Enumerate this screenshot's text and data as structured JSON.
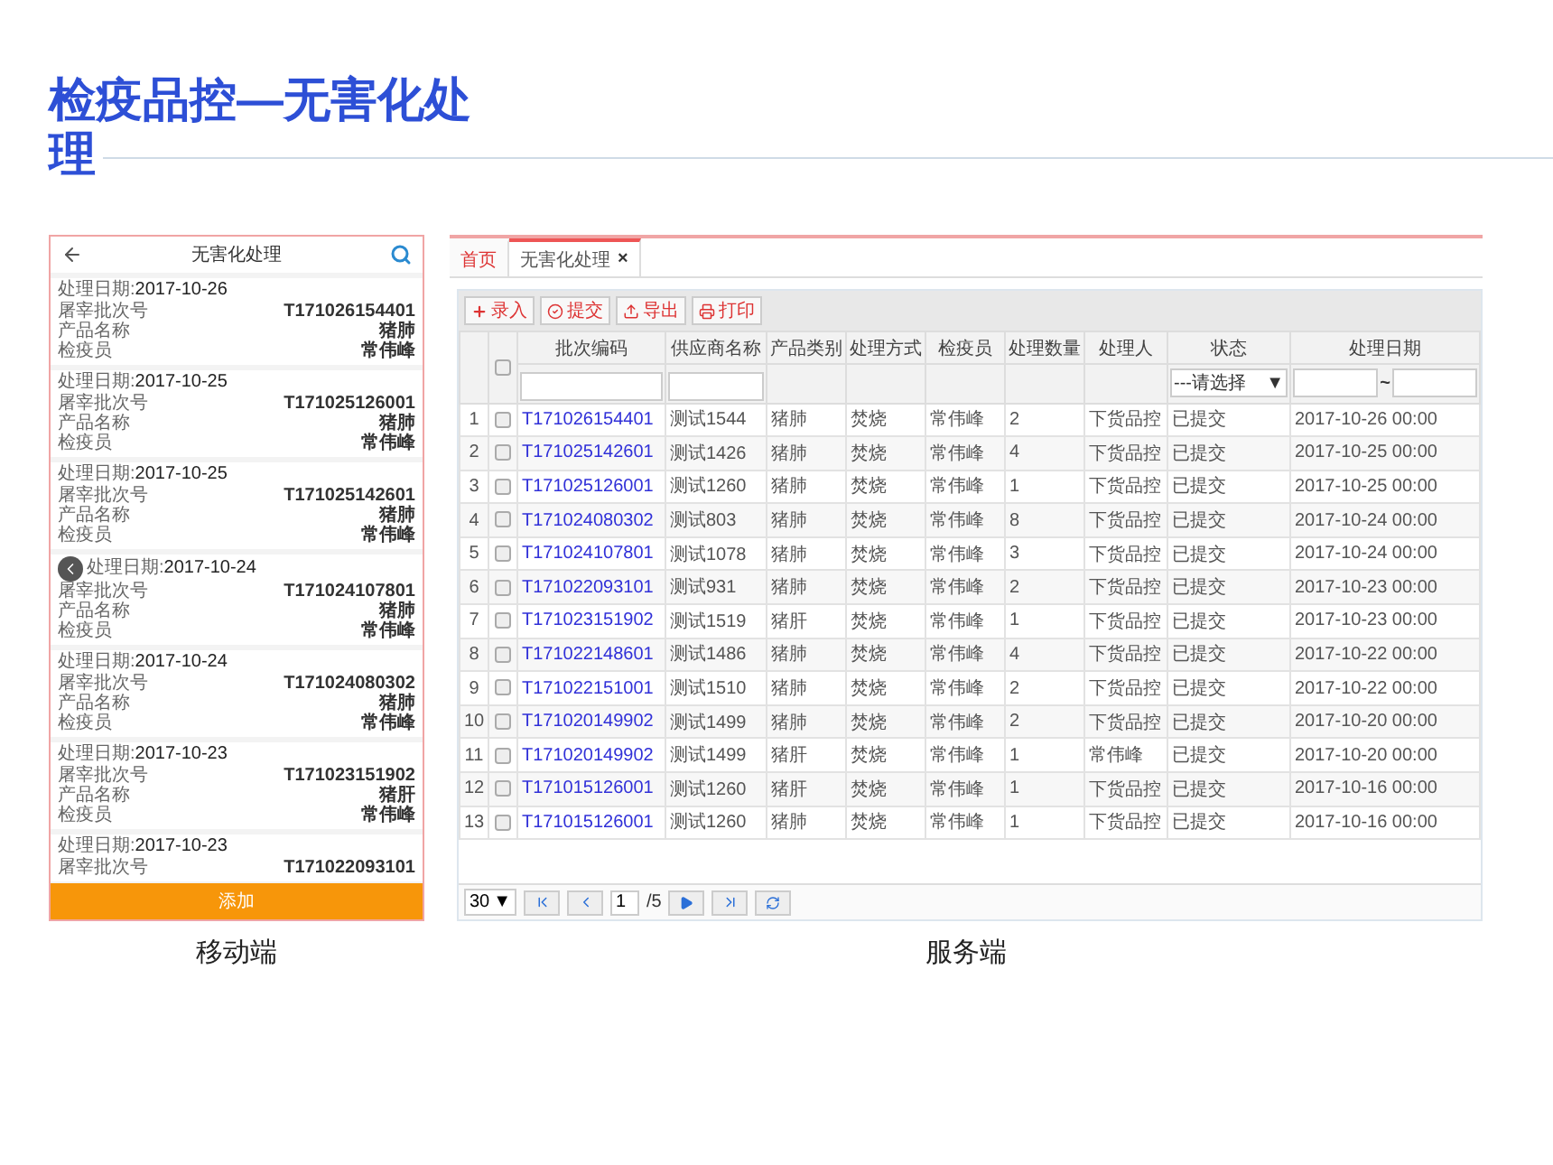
{
  "title": "检疫品控—无害化处理",
  "mobile": {
    "header": "无害化处理",
    "caption": "移动端",
    "add_button": "添加",
    "cards": [
      {
        "title": "处理日期:**2017-10-26**",
        "fields": [
          {
            "label": "屠宰批次号",
            "value": "T171026154401"
          },
          {
            "label": "产品名称",
            "value": "猪肺"
          },
          {
            "label": "检疫员",
            "value": "常伟峰"
          }
        ]
      },
      {
        "title": "处理日期:**2017-10-25**",
        "fields": [
          {
            "label": "屠宰批次号",
            "value": "T171025126001"
          },
          {
            "label": "产品名称",
            "value": "猪肺"
          },
          {
            "label": "检疫员",
            "value": "常伟峰"
          }
        ]
      },
      {
        "title": "处理日期:**2017-10-25**",
        "fields": [
          {
            "label": "屠宰批次号",
            "value": "T171025142601"
          },
          {
            "label": "产品名称",
            "value": "猪肺"
          },
          {
            "label": "检疫员",
            "value": "常伟峰"
          }
        ]
      },
      {
        "title": "处理日期:**2017-10-24**",
        "fields": [
          {
            "label": "屠宰批次号",
            "value": "T171024107801"
          },
          {
            "label": "产品名称",
            "value": "猪肺"
          },
          {
            "label": "检疫员",
            "value": "常伟峰"
          }
        ]
      },
      {
        "title": "处理日期:**2017-10-24**",
        "fields": [
          {
            "label": "屠宰批次号",
            "value": "T171024080302"
          },
          {
            "label": "产品名称",
            "value": "猪肺"
          },
          {
            "label": "检疫员",
            "value": "常伟峰"
          }
        ]
      },
      {
        "title": "处理日期:**2017-10-23**",
        "fields": [
          {
            "label": "屠宰批次号",
            "value": "T171023151902"
          },
          {
            "label": "产品名称",
            "value": "猪肝"
          },
          {
            "label": "检疫员",
            "value": "常伟峰"
          }
        ]
      },
      {
        "title": "处理日期:**2017-10-23**",
        "fields": [
          {
            "label": "屠宰批次号",
            "value": "T171022093101"
          }
        ]
      }
    ]
  },
  "server": {
    "caption": "服务端",
    "tabs": [
      {
        "label": "首页",
        "selected": false,
        "closable": false
      },
      {
        "label": "无害化处理",
        "selected": true,
        "closable": true
      }
    ],
    "close_mark": "×",
    "toolbar": [
      {
        "kind": "add",
        "label": "录入"
      },
      {
        "kind": "submit",
        "label": "提交"
      },
      {
        "kind": "export",
        "label": "导出"
      },
      {
        "kind": "print",
        "label": "打印"
      }
    ],
    "columns": [
      "批次编码",
      "供应商名称",
      "产品类别",
      "处理方式",
      "检疫员",
      "处理数量",
      "处理人",
      "状态",
      "处理日期"
    ],
    "header_checked": false,
    "status_filter": "---请选择",
    "dropdown_mark": "▼",
    "date_separator": "~",
    "rows": [
      {
        "no": "1",
        "checked": false,
        "cells": [
          "T171026154401",
          "测试1544",
          "猪肺",
          "焚烧",
          "常伟峰",
          "2",
          "下货品控",
          "已提交",
          "2017-10-26 00:00"
        ]
      },
      {
        "no": "2",
        "checked": false,
        "cells": [
          "T171025142601",
          "测试1426",
          "猪肺",
          "焚烧",
          "常伟峰",
          "4",
          "下货品控",
          "已提交",
          "2017-10-25 00:00"
        ]
      },
      {
        "no": "3",
        "checked": false,
        "cells": [
          "T171025126001",
          "测试1260",
          "猪肺",
          "焚烧",
          "常伟峰",
          "1",
          "下货品控",
          "已提交",
          "2017-10-25 00:00"
        ]
      },
      {
        "no": "4",
        "checked": false,
        "cells": [
          "T171024080302",
          "测试803",
          "猪肺",
          "焚烧",
          "常伟峰",
          "8",
          "下货品控",
          "已提交",
          "2017-10-24 00:00"
        ]
      },
      {
        "no": "5",
        "checked": false,
        "cells": [
          "T171024107801",
          "测试1078",
          "猪肺",
          "焚烧",
          "常伟峰",
          "3",
          "下货品控",
          "已提交",
          "2017-10-24 00:00"
        ]
      },
      {
        "no": "6",
        "checked": false,
        "cells": [
          "T171022093101",
          "测试931",
          "猪肺",
          "焚烧",
          "常伟峰",
          "2",
          "下货品控",
          "已提交",
          "2017-10-23 00:00"
        ]
      },
      {
        "no": "7",
        "checked": false,
        "cells": [
          "T171023151902",
          "测试1519",
          "猪肝",
          "焚烧",
          "常伟峰",
          "1",
          "下货品控",
          "已提交",
          "2017-10-23 00:00"
        ]
      },
      {
        "no": "8",
        "checked": false,
        "cells": [
          "T171022148601",
          "测试1486",
          "猪肺",
          "焚烧",
          "常伟峰",
          "4",
          "下货品控",
          "已提交",
          "2017-10-22 00:00"
        ]
      },
      {
        "no": "9",
        "checked": false,
        "cells": [
          "T171022151001",
          "测试1510",
          "猪肺",
          "焚烧",
          "常伟峰",
          "2",
          "下货品控",
          "已提交",
          "2017-10-22 00:00"
        ]
      },
      {
        "no": "10",
        "checked": false,
        "cells": [
          "T171020149902",
          "测试1499",
          "猪肺",
          "焚烧",
          "常伟峰",
          "2",
          "下货品控",
          "已提交",
          "2017-10-20 00:00"
        ]
      },
      {
        "no": "11",
        "checked": false,
        "cells": [
          "T171020149902",
          "测试1499",
          "猪肝",
          "焚烧",
          "常伟峰",
          "1",
          "常伟峰",
          "已提交",
          "2017-10-20 00:00"
        ]
      },
      {
        "no": "12",
        "checked": false,
        "cells": [
          "T171015126001",
          "测试1260",
          "猪肝",
          "焚烧",
          "常伟峰",
          "1",
          "下货品控",
          "已提交",
          "2017-10-16 00:00"
        ]
      },
      {
        "no": "13",
        "checked": false,
        "cells": [
          "T171015126001",
          "测试1260",
          "猪肺",
          "焚烧",
          "常伟峰",
          "1",
          "下货品控",
          "已提交",
          "2017-10-16 00:00"
        ]
      }
    ],
    "pager": {
      "page_size": "30",
      "page": "1",
      "total": "/5"
    }
  }
}
